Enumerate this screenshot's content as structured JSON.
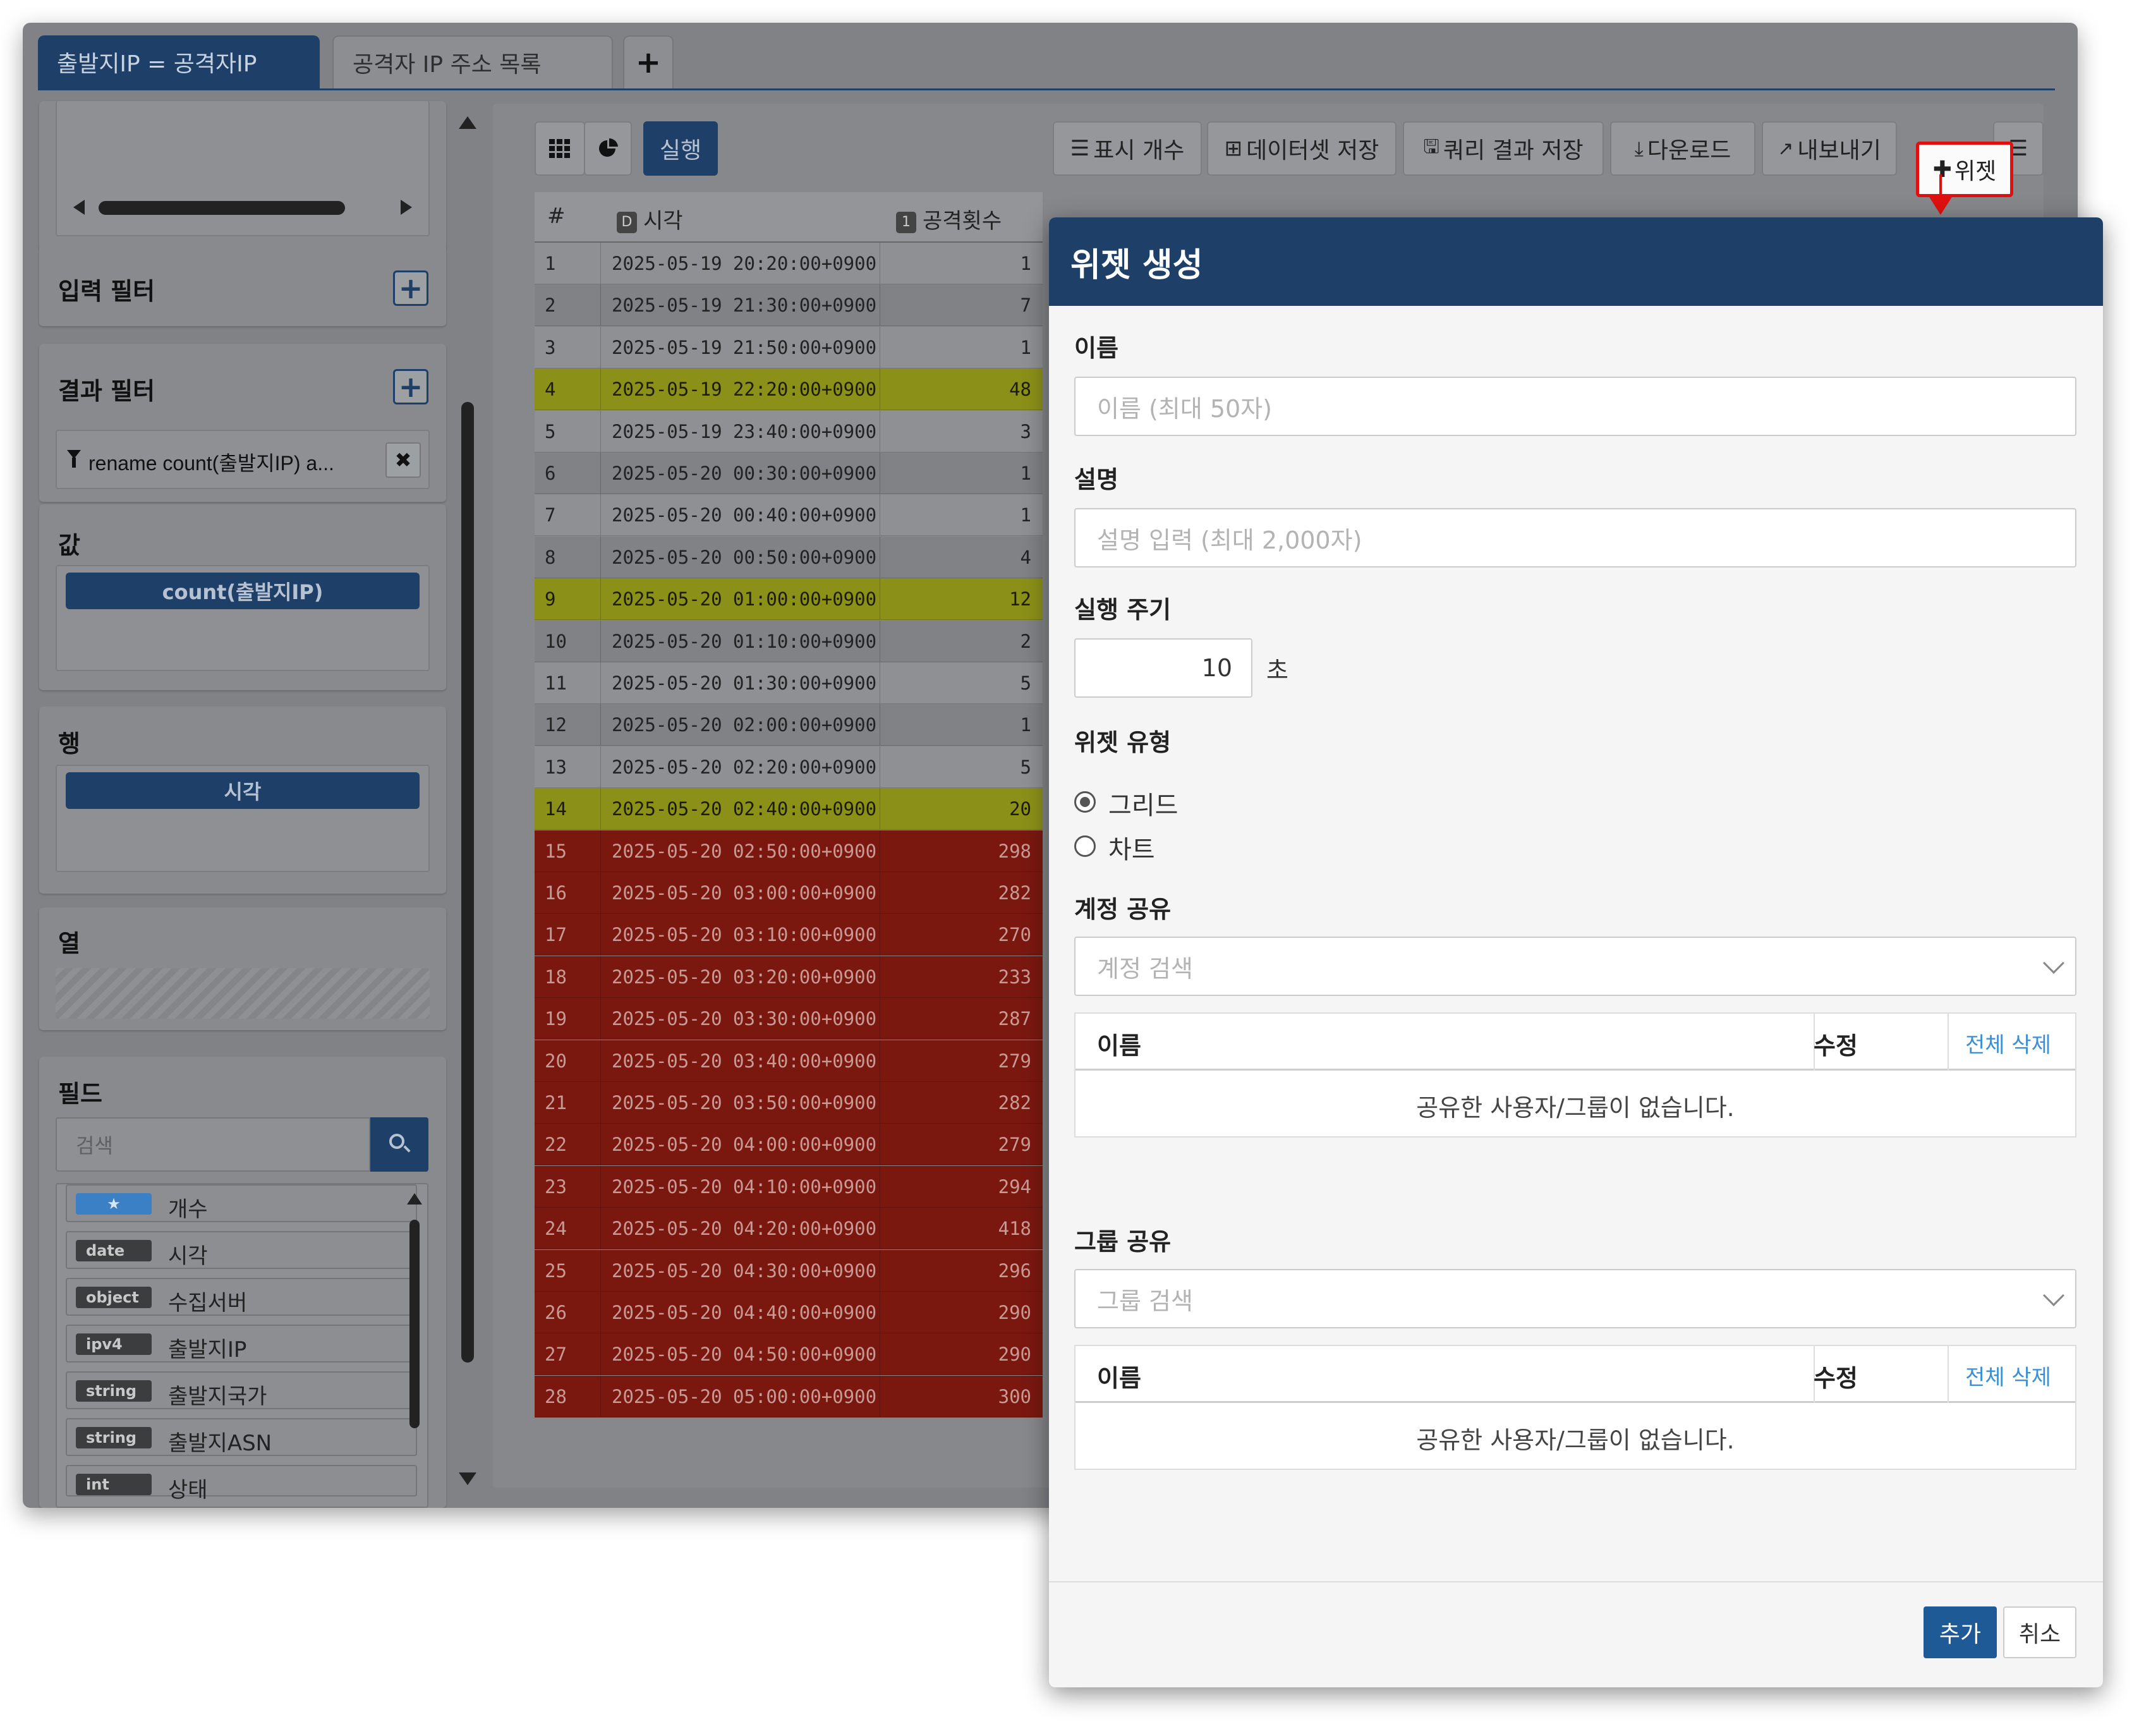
{
  "tabs": [
    {
      "label": "출발지IP = 공격자IP"
    },
    {
      "label": "공격자 IP 주소 목록"
    }
  ],
  "add_tab_label": "+",
  "left": {
    "input_filter": {
      "title": "입력 필터",
      "add": "+"
    },
    "result_filter": {
      "title": "결과 필터",
      "add": "+",
      "item": "rename count(출발지IP) a...",
      "remove": "✖"
    },
    "values": {
      "title": "값",
      "item": "count(출발지IP)"
    },
    "rows": {
      "title": "행",
      "item": "시각"
    },
    "columns": {
      "title": "열"
    },
    "fields": {
      "title": "필드",
      "search_placeholder": "검색",
      "items": [
        {
          "type": "★",
          "name": "개수"
        },
        {
          "type": "date",
          "name": "시각"
        },
        {
          "type": "object",
          "name": "수집서버"
        },
        {
          "type": "ipv4",
          "name": "출발지IP"
        },
        {
          "type": "string",
          "name": "출발지국가"
        },
        {
          "type": "string",
          "name": "출발지ASN"
        },
        {
          "type": "int",
          "name": "상태"
        }
      ]
    }
  },
  "toolbar": {
    "run": "실행",
    "display_count": "표시 개수",
    "save_dataset": "데이터셋 저장",
    "save_query": "쿼리 결과 저장",
    "download": "다운로드",
    "export": "내보내기",
    "widget": "위젯"
  },
  "table": {
    "headers": {
      "num": "#",
      "time_badge": "D",
      "time": "시각",
      "count_badge": "1",
      "count": "공격횟수"
    },
    "rows": [
      {
        "n": "1",
        "t": "2025-05-19 20:20:00+0900",
        "c": "1",
        "hl": "gray"
      },
      {
        "n": "2",
        "t": "2025-05-19 21:30:00+0900",
        "c": "7",
        "hl": "gray"
      },
      {
        "n": "3",
        "t": "2025-05-19 21:50:00+0900",
        "c": "1",
        "hl": "gray"
      },
      {
        "n": "4",
        "t": "2025-05-19 22:20:00+0900",
        "c": "48",
        "hl": "yellow"
      },
      {
        "n": "5",
        "t": "2025-05-19 23:40:00+0900",
        "c": "3",
        "hl": "gray"
      },
      {
        "n": "6",
        "t": "2025-05-20 00:30:00+0900",
        "c": "1",
        "hl": "gray"
      },
      {
        "n": "7",
        "t": "2025-05-20 00:40:00+0900",
        "c": "1",
        "hl": "gray"
      },
      {
        "n": "8",
        "t": "2025-05-20 00:50:00+0900",
        "c": "4",
        "hl": "gray"
      },
      {
        "n": "9",
        "t": "2025-05-20 01:00:00+0900",
        "c": "12",
        "hl": "yellow"
      },
      {
        "n": "10",
        "t": "2025-05-20 01:10:00+0900",
        "c": "2",
        "hl": "gray"
      },
      {
        "n": "11",
        "t": "2025-05-20 01:30:00+0900",
        "c": "5",
        "hl": "gray"
      },
      {
        "n": "12",
        "t": "2025-05-20 02:00:00+0900",
        "c": "1",
        "hl": "gray"
      },
      {
        "n": "13",
        "t": "2025-05-20 02:20:00+0900",
        "c": "5",
        "hl": "gray"
      },
      {
        "n": "14",
        "t": "2025-05-20 02:40:00+0900",
        "c": "20",
        "hl": "yellow"
      },
      {
        "n": "15",
        "t": "2025-05-20 02:50:00+0900",
        "c": "298",
        "hl": "red"
      },
      {
        "n": "16",
        "t": "2025-05-20 03:00:00+0900",
        "c": "282",
        "hl": "red"
      },
      {
        "n": "17",
        "t": "2025-05-20 03:10:00+0900",
        "c": "270",
        "hl": "red"
      },
      {
        "n": "18",
        "t": "2025-05-20 03:20:00+0900",
        "c": "233",
        "hl": "red"
      },
      {
        "n": "19",
        "t": "2025-05-20 03:30:00+0900",
        "c": "287",
        "hl": "red"
      },
      {
        "n": "20",
        "t": "2025-05-20 03:40:00+0900",
        "c": "279",
        "hl": "red"
      },
      {
        "n": "21",
        "t": "2025-05-20 03:50:00+0900",
        "c": "282",
        "hl": "red"
      },
      {
        "n": "22",
        "t": "2025-05-20 04:00:00+0900",
        "c": "279",
        "hl": "red"
      },
      {
        "n": "23",
        "t": "2025-05-20 04:10:00+0900",
        "c": "294",
        "hl": "red"
      },
      {
        "n": "24",
        "t": "2025-05-20 04:20:00+0900",
        "c": "418",
        "hl": "red"
      },
      {
        "n": "25",
        "t": "2025-05-20 04:30:00+0900",
        "c": "296",
        "hl": "red"
      },
      {
        "n": "26",
        "t": "2025-05-20 04:40:00+0900",
        "c": "290",
        "hl": "red"
      },
      {
        "n": "27",
        "t": "2025-05-20 04:50:00+0900",
        "c": "290",
        "hl": "red"
      },
      {
        "n": "28",
        "t": "2025-05-20 05:00:00+0900",
        "c": "300",
        "hl": "red"
      }
    ]
  },
  "modal": {
    "title": "위젯 생성",
    "name_label": "이름",
    "name_placeholder": "이름 (최대 50자)",
    "desc_label": "설명",
    "desc_placeholder": "설명 입력 (최대 2,000자)",
    "interval_label": "실행 주기",
    "interval_value": "10",
    "interval_unit": "초",
    "type_label": "위젯 유형",
    "type_grid": "그리드",
    "type_chart": "차트",
    "type_selected": "그리드",
    "account_label": "계정 공유",
    "account_placeholder": "계정 검색",
    "group_label": "그룹 공유",
    "group_placeholder": "그룹 검색",
    "share_col_name": "이름",
    "share_col_edit": "수정",
    "share_delete_all": "전체 삭제",
    "share_empty": "공유한 사용자/그룹이 없습니다.",
    "add_button": "추가",
    "cancel_button": "취소"
  },
  "colors": {
    "navy": "#1e3f68",
    "highlight_yellow": "#8b9019",
    "highlight_red": "#7a1810",
    "callout_red": "#e01010",
    "link_blue": "#3b8fd6"
  }
}
